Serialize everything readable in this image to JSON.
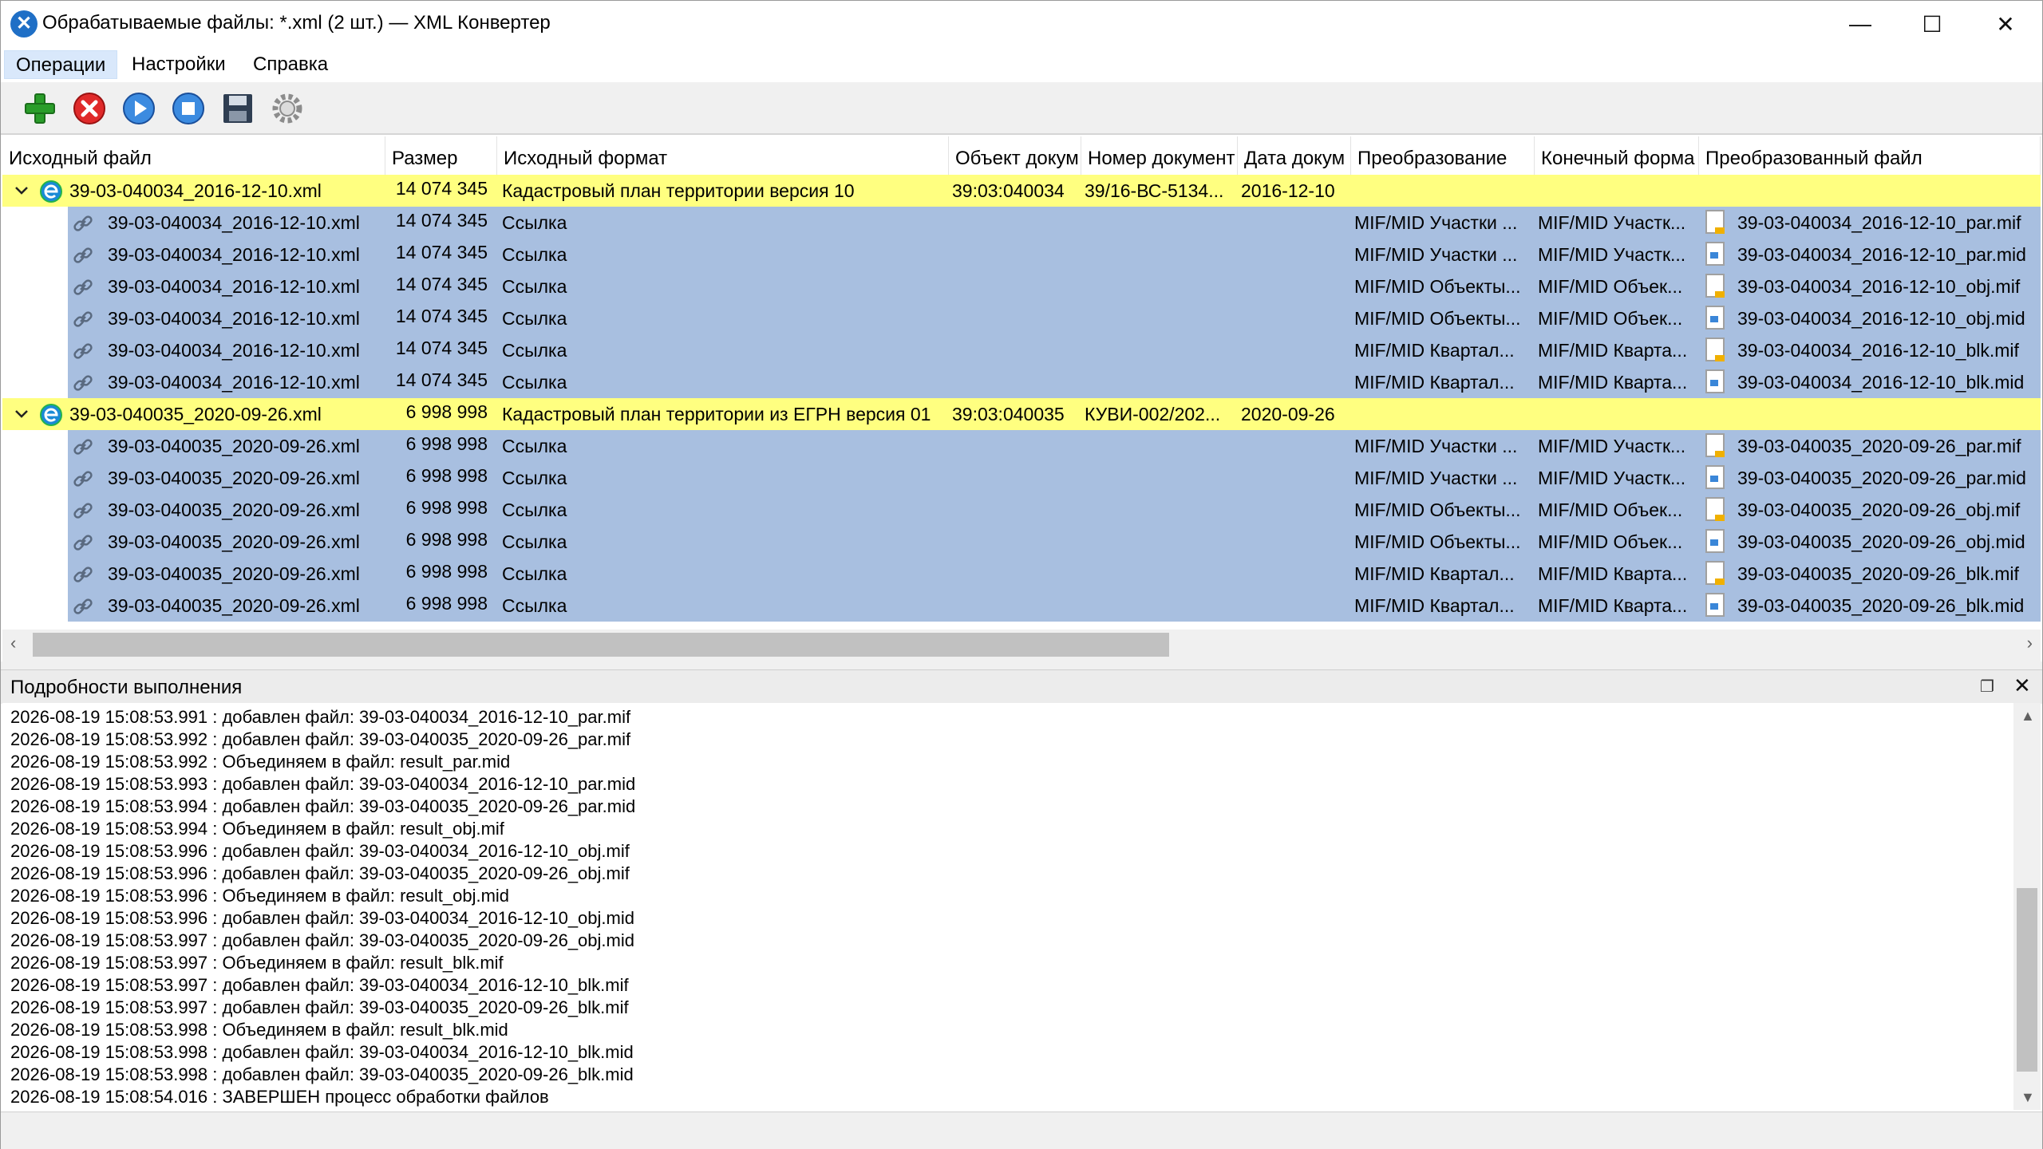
{
  "window": {
    "title": "Обрабатываемые файлы: *.xml (2 шт.) — XML Конвертер",
    "app_icon": "x-logo-icon",
    "controls": {
      "minimize": "—",
      "maximize": "☐",
      "close": "✕"
    }
  },
  "menu": {
    "items": [
      "Операции",
      "Настройки",
      "Справка"
    ]
  },
  "toolbar": {
    "buttons": [
      "add-icon",
      "remove-icon",
      "play-icon",
      "stop-icon",
      "save-icon",
      "settings-icon"
    ]
  },
  "grid": {
    "columns": [
      "Исходный файл",
      "Размер",
      "Исходный формат",
      "Объект докум",
      "Номер документ",
      "Дата докум",
      "Преобразование",
      "Конечный форма",
      "Преобразованный файл"
    ],
    "groups": [
      {
        "parent": {
          "file": "39-03-040034_2016-12-10.xml",
          "size": "14 074 345",
          "format": "Кадастровый план территории версия 10",
          "object": "39:03:040034",
          "doc_number": "39/16-ВС-5134...",
          "doc_date": "2016-12-10"
        },
        "children": [
          {
            "file": "39-03-040034_2016-12-10.xml",
            "size": "14 074 345",
            "format": "Ссылка",
            "conv": "MIF/MID Участки ...",
            "target": "MIF/MID Участк...",
            "out_type": "mif",
            "out": "39-03-040034_2016-12-10_par.mif"
          },
          {
            "file": "39-03-040034_2016-12-10.xml",
            "size": "14 074 345",
            "format": "Ссылка",
            "conv": "MIF/MID Участки ...",
            "target": "MIF/MID Участк...",
            "out_type": "mid",
            "out": "39-03-040034_2016-12-10_par.mid"
          },
          {
            "file": "39-03-040034_2016-12-10.xml",
            "size": "14 074 345",
            "format": "Ссылка",
            "conv": "MIF/MID Объекты...",
            "target": "MIF/MID Объек...",
            "out_type": "mif",
            "out": "39-03-040034_2016-12-10_obj.mif"
          },
          {
            "file": "39-03-040034_2016-12-10.xml",
            "size": "14 074 345",
            "format": "Ссылка",
            "conv": "MIF/MID Объекты...",
            "target": "MIF/MID Объек...",
            "out_type": "mid",
            "out": "39-03-040034_2016-12-10_obj.mid"
          },
          {
            "file": "39-03-040034_2016-12-10.xml",
            "size": "14 074 345",
            "format": "Ссылка",
            "conv": "MIF/MID Квартал...",
            "target": "MIF/MID Кварта...",
            "out_type": "mif",
            "out": "39-03-040034_2016-12-10_blk.mif"
          },
          {
            "file": "39-03-040034_2016-12-10.xml",
            "size": "14 074 345",
            "format": "Ссылка",
            "conv": "MIF/MID Квартал...",
            "target": "MIF/MID Кварта...",
            "out_type": "mid",
            "out": "39-03-040034_2016-12-10_blk.mid"
          }
        ]
      },
      {
        "parent": {
          "file": "39-03-040035_2020-09-26.xml",
          "size": "6 998 998",
          "format": "Кадастровый план территории из ЕГРН версия 01",
          "object": "39:03:040035",
          "doc_number": "КУВИ-002/202...",
          "doc_date": "2020-09-26"
        },
        "children": [
          {
            "file": "39-03-040035_2020-09-26.xml",
            "size": "6 998 998",
            "format": "Ссылка",
            "conv": "MIF/MID Участки ...",
            "target": "MIF/MID Участк...",
            "out_type": "mif",
            "out": "39-03-040035_2020-09-26_par.mif"
          },
          {
            "file": "39-03-040035_2020-09-26.xml",
            "size": "6 998 998",
            "format": "Ссылка",
            "conv": "MIF/MID Участки ...",
            "target": "MIF/MID Участк...",
            "out_type": "mid",
            "out": "39-03-040035_2020-09-26_par.mid"
          },
          {
            "file": "39-03-040035_2020-09-26.xml",
            "size": "6 998 998",
            "format": "Ссылка",
            "conv": "MIF/MID Объекты...",
            "target": "MIF/MID Объек...",
            "out_type": "mif",
            "out": "39-03-040035_2020-09-26_obj.mif"
          },
          {
            "file": "39-03-040035_2020-09-26.xml",
            "size": "6 998 998",
            "format": "Ссылка",
            "conv": "MIF/MID Объекты...",
            "target": "MIF/MID Объек...",
            "out_type": "mid",
            "out": "39-03-040035_2020-09-26_obj.mid"
          },
          {
            "file": "39-03-040035_2020-09-26.xml",
            "size": "6 998 998",
            "format": "Ссылка",
            "conv": "MIF/MID Квартал...",
            "target": "MIF/MID Кварта...",
            "out_type": "mif",
            "out": "39-03-040035_2020-09-26_blk.mif"
          },
          {
            "file": "39-03-040035_2020-09-26.xml",
            "size": "6 998 998",
            "format": "Ссылка",
            "conv": "MIF/MID Квартал...",
            "target": "MIF/MID Кварта...",
            "out_type": "mid",
            "out": "39-03-040035_2020-09-26_blk.mid"
          }
        ]
      }
    ]
  },
  "details": {
    "title": "Подробности выполнения",
    "log": [
      "2026-08-19 15:08:53.991 : добавлен файл: 39-03-040034_2016-12-10_par.mif",
      "2026-08-19 15:08:53.992 : добавлен файл: 39-03-040035_2020-09-26_par.mif",
      "2026-08-19 15:08:53.992 : Объединяем в файл: result_par.mid",
      "2026-08-19 15:08:53.993 : добавлен файл: 39-03-040034_2016-12-10_par.mid",
      "2026-08-19 15:08:53.994 : добавлен файл: 39-03-040035_2020-09-26_par.mid",
      "2026-08-19 15:08:53.994 : Объединяем в файл: result_obj.mif",
      "2026-08-19 15:08:53.996 : добавлен файл: 39-03-040034_2016-12-10_obj.mif",
      "2026-08-19 15:08:53.996 : добавлен файл: 39-03-040035_2020-09-26_obj.mif",
      "2026-08-19 15:08:53.996 : Объединяем в файл: result_obj.mid",
      "2026-08-19 15:08:53.996 : добавлен файл: 39-03-040034_2016-12-10_obj.mid",
      "2026-08-19 15:08:53.997 : добавлен файл: 39-03-040035_2020-09-26_obj.mid",
      "2026-08-19 15:08:53.997 : Объединяем в файл: result_blk.mif",
      "2026-08-19 15:08:53.997 : добавлен файл: 39-03-040034_2016-12-10_blk.mif",
      "2026-08-19 15:08:53.997 : добавлен файл: 39-03-040035_2020-09-26_blk.mif",
      "2026-08-19 15:08:53.998 : Объединяем в файл: result_blk.mid",
      "2026-08-19 15:08:53.998 : добавлен файл: 39-03-040034_2016-12-10_blk.mid",
      "2026-08-19 15:08:53.998 : добавлен файл: 39-03-040035_2020-09-26_blk.mid",
      "2026-08-19 15:08:54.016 : ЗАВЕРШЕН процесс обработки файлов"
    ]
  },
  "colors": {
    "parent_row": "#ffff80",
    "child_row": "#a8bfe0",
    "menu_active": "#d9e8fb"
  }
}
